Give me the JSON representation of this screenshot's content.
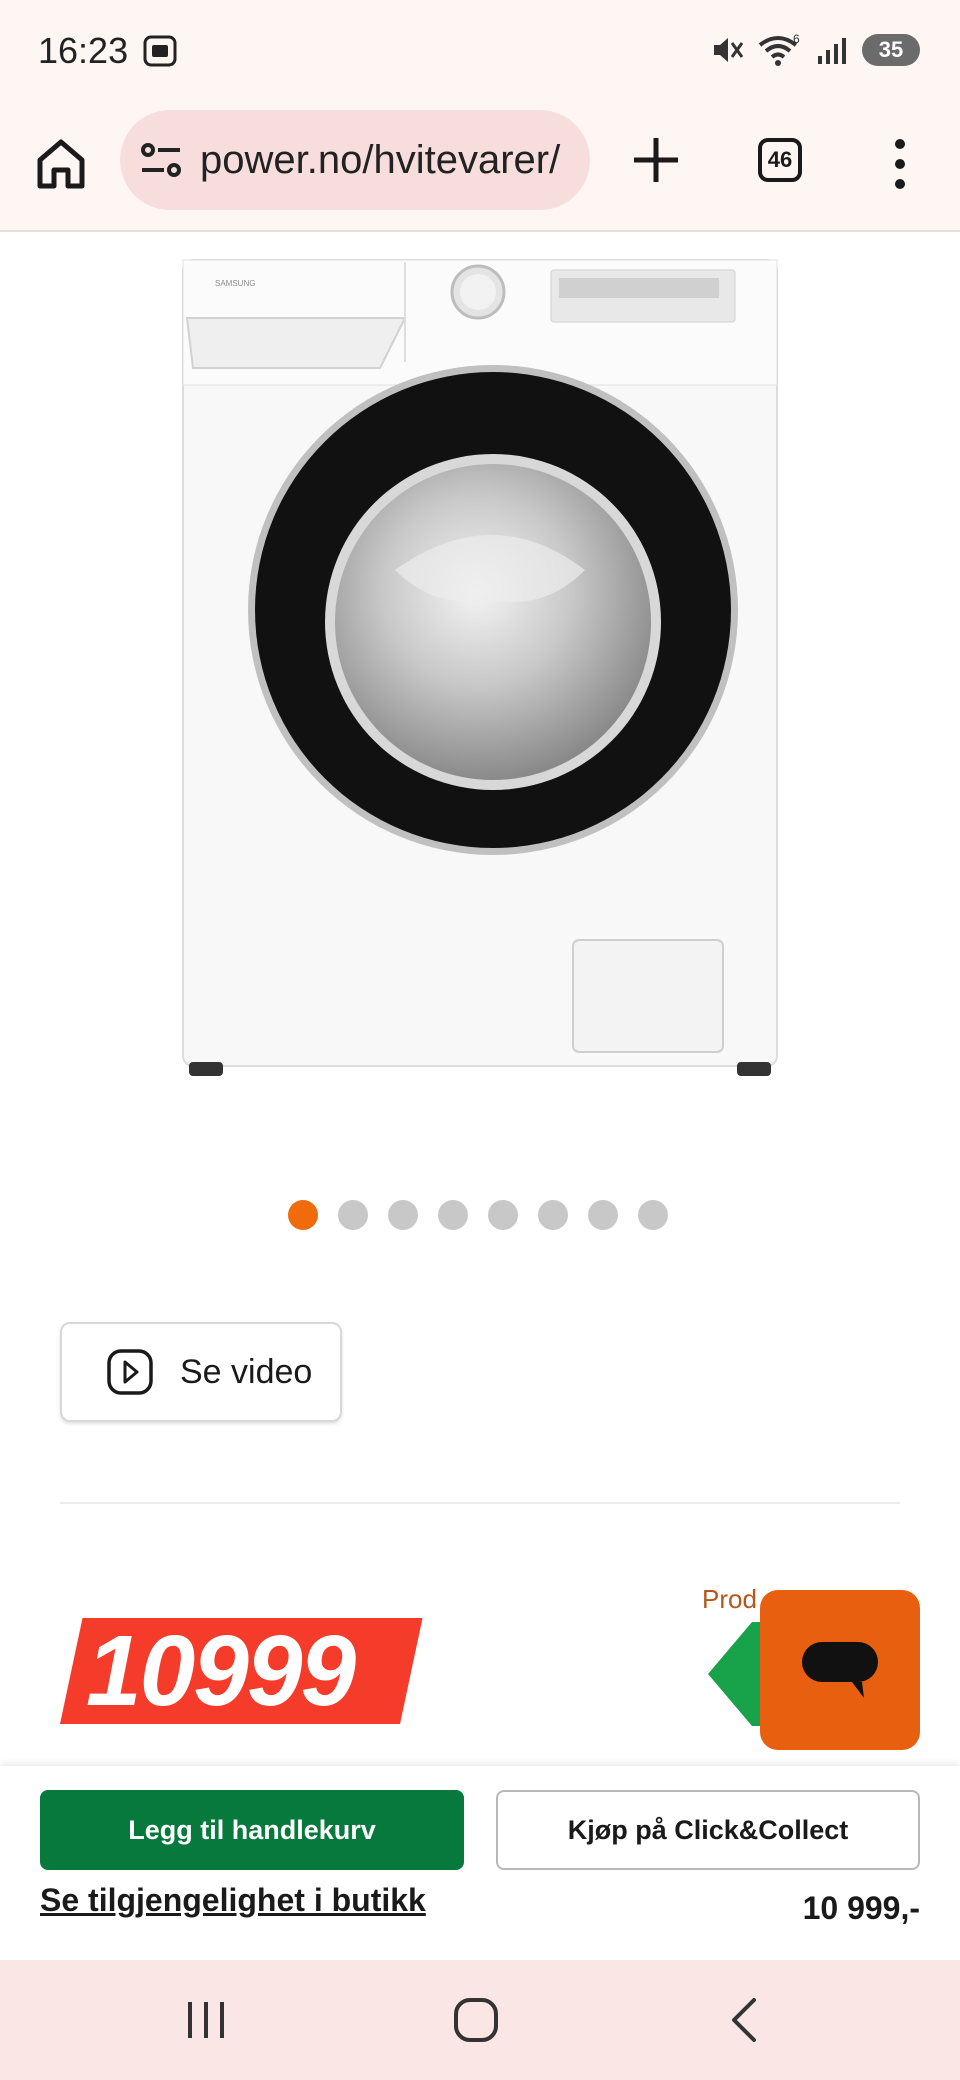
{
  "status_bar": {
    "time": "16:23",
    "battery": "35"
  },
  "browser": {
    "url": "power.no/hvitevarer/",
    "tab_count": "46"
  },
  "gallery": {
    "dot_count": 8,
    "active_index": 0,
    "active_color": "#ef6b0c"
  },
  "video_button": {
    "label": "Se video"
  },
  "price": {
    "big": "10999",
    "badge_color": "#f53c2b",
    "label_partial": "Prod"
  },
  "buy_panel": {
    "add_to_cart": "Legg til handlekurv",
    "click_collect": "Kjøp på Click&Collect",
    "availability": "Se tilgjengelighet i butikk",
    "price": "10 999,-",
    "add_to_cart_color": "#07793d"
  },
  "chat": {
    "color": "#e8600f"
  }
}
